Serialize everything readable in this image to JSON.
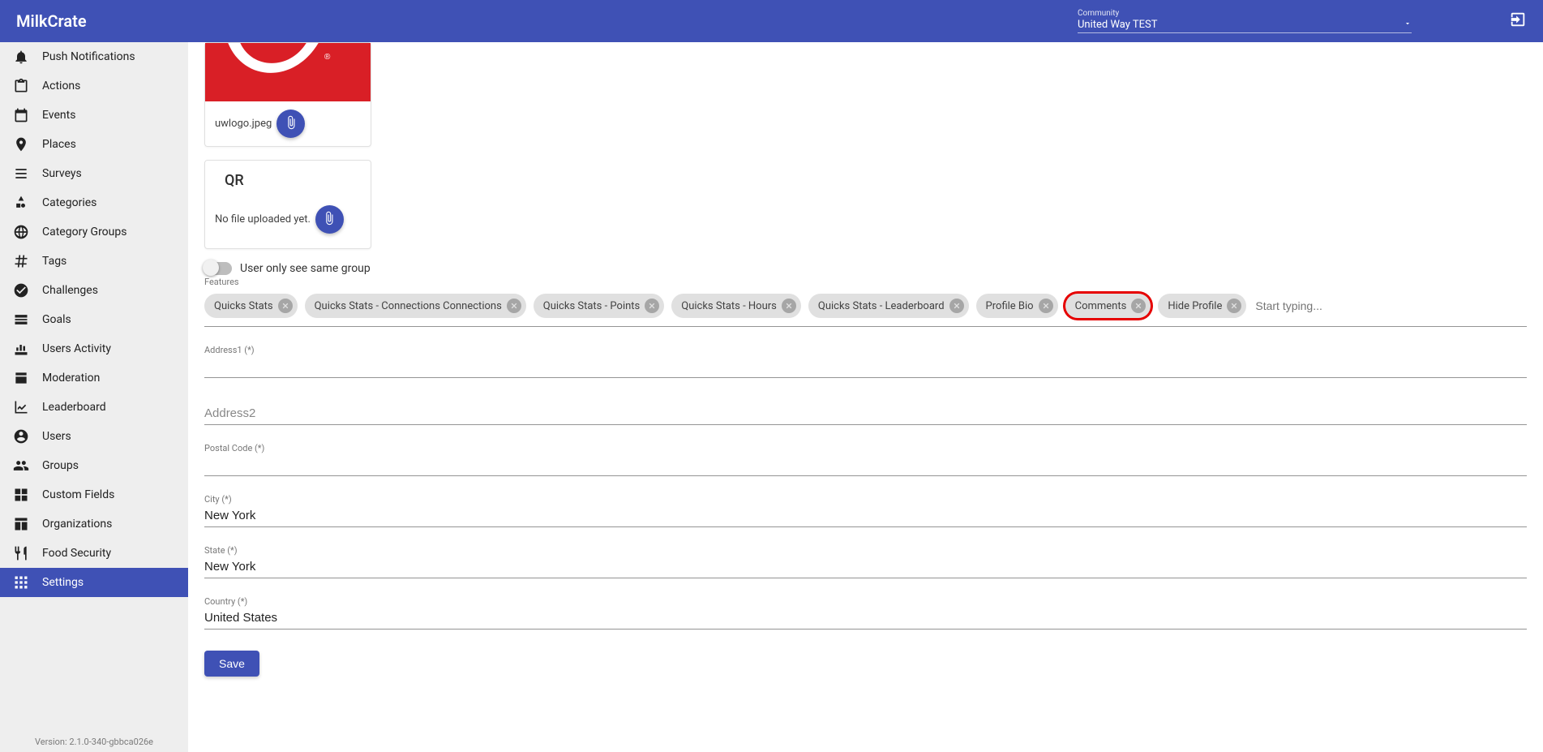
{
  "header": {
    "brand": "MilkCrate",
    "community_label": "Community",
    "community_value": "United Way TEST"
  },
  "sidebar": {
    "items": [
      {
        "label": "Push Notifications",
        "icon": "bell-icon"
      },
      {
        "label": "Actions",
        "icon": "clipboard-icon"
      },
      {
        "label": "Events",
        "icon": "calendar-icon"
      },
      {
        "label": "Places",
        "icon": "pin-icon"
      },
      {
        "label": "Surveys",
        "icon": "list-icon"
      },
      {
        "label": "Categories",
        "icon": "shapes-icon"
      },
      {
        "label": "Category Groups",
        "icon": "globe-icon"
      },
      {
        "label": "Tags",
        "icon": "hash-icon"
      },
      {
        "label": "Challenges",
        "icon": "check-circle-icon"
      },
      {
        "label": "Goals",
        "icon": "gauge-icon"
      },
      {
        "label": "Users Activity",
        "icon": "activity-icon"
      },
      {
        "label": "Moderation",
        "icon": "moderation-icon"
      },
      {
        "label": "Leaderboard",
        "icon": "chart-icon"
      },
      {
        "label": "Users",
        "icon": "users-globe-icon"
      },
      {
        "label": "Groups",
        "icon": "group-icon"
      },
      {
        "label": "Custom Fields",
        "icon": "grid-icon"
      },
      {
        "label": "Organizations",
        "icon": "org-icon"
      },
      {
        "label": "Food Security",
        "icon": "food-icon"
      },
      {
        "label": "Settings",
        "icon": "settings-grid-icon",
        "active": true
      }
    ],
    "version": "Version: 2.1.0-340-gbbca026e"
  },
  "logo_card": {
    "filename": "uwlogo.jpeg"
  },
  "qr_card": {
    "title": "QR",
    "nofile": "No file uploaded yet."
  },
  "toggle": {
    "label": "User only see same group"
  },
  "features": {
    "label": "Features",
    "chips": [
      {
        "label": "Quicks Stats"
      },
      {
        "label": "Quicks Stats - Connections Connections"
      },
      {
        "label": "Quicks Stats - Points"
      },
      {
        "label": "Quicks Stats - Hours"
      },
      {
        "label": "Quicks Stats - Leaderboard"
      },
      {
        "label": "Profile Bio"
      },
      {
        "label": "Comments",
        "highlight": true
      },
      {
        "label": "Hide Profile"
      }
    ],
    "input_placeholder": "Start typing..."
  },
  "fields": {
    "address1": {
      "label": "Address1 (*)",
      "value": ""
    },
    "address2": {
      "placeholder": "Address2",
      "value": ""
    },
    "postal": {
      "label": "Postal Code (*)",
      "value": ""
    },
    "city": {
      "label": "City (*)",
      "value": "New York"
    },
    "state": {
      "label": "State (*)",
      "value": "New York"
    },
    "country": {
      "label": "Country (*)",
      "value": "United States"
    }
  },
  "save_label": "Save"
}
